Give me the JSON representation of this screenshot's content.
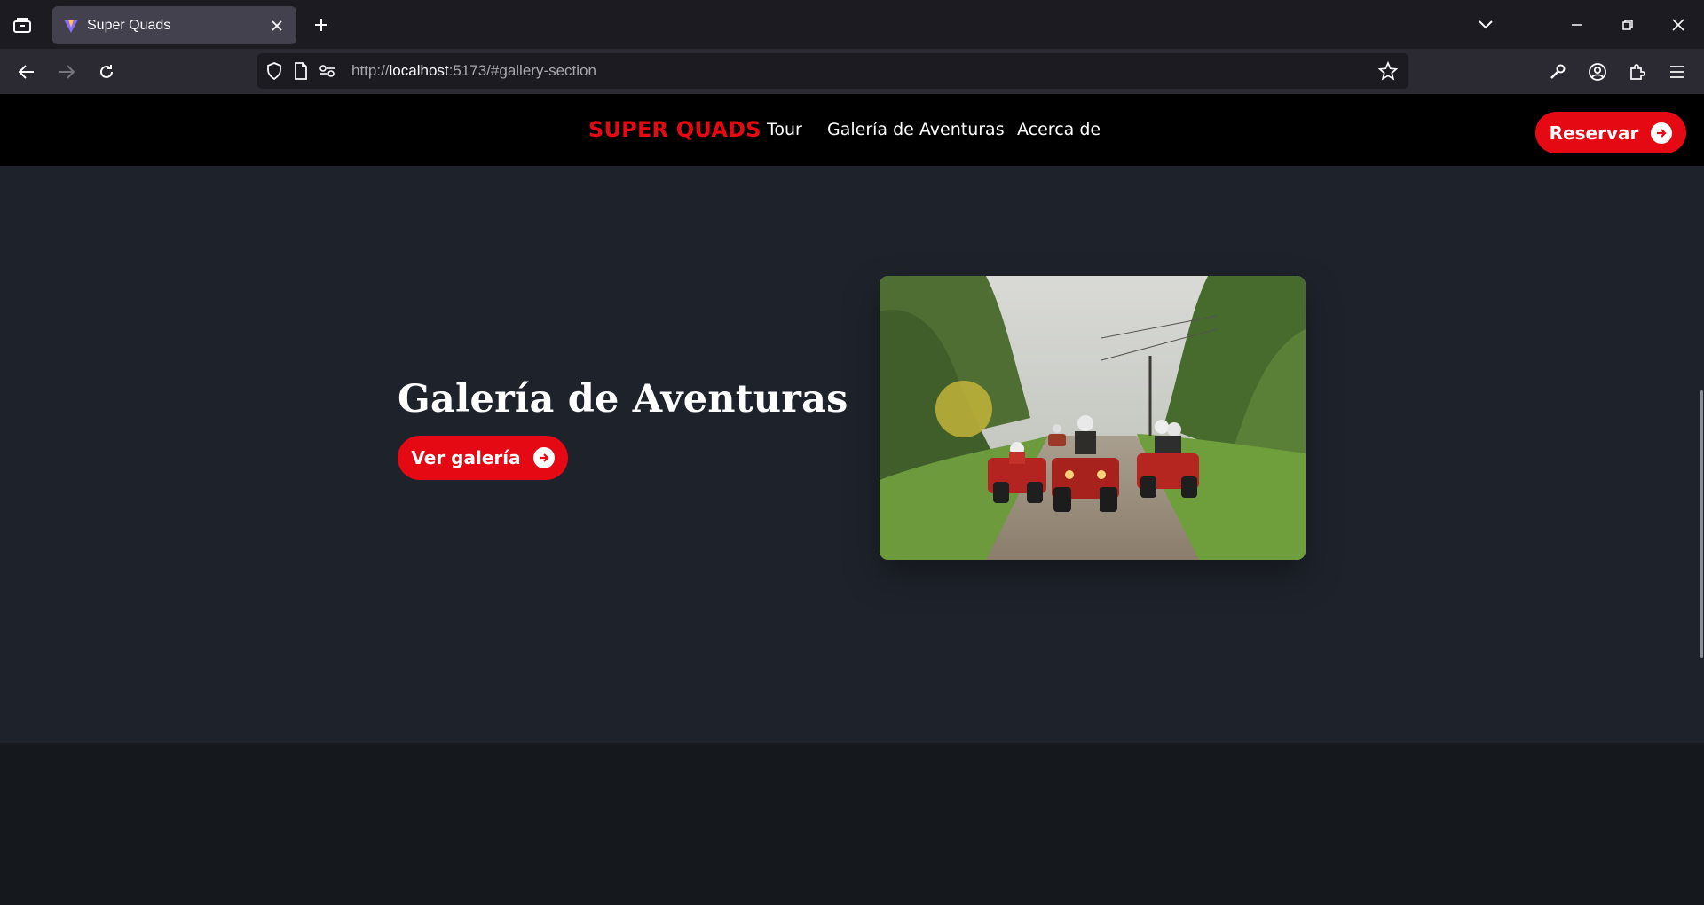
{
  "browser": {
    "tab_title": "Super Quads",
    "url_scheme": "http://",
    "url_host": "localhost",
    "url_rest": ":5173/#gallery-section"
  },
  "site": {
    "brand": "SUPER QUADS",
    "nav": [
      "Tour",
      "Galería de Aventuras",
      "Acerca de"
    ],
    "reserve_label": "Reservar"
  },
  "gallery": {
    "title": "Galería de Aventuras",
    "button_label": "Ver galería"
  },
  "colors": {
    "accent": "#e50914",
    "header_bg": "#000000",
    "section_bg": "#1e232b"
  }
}
